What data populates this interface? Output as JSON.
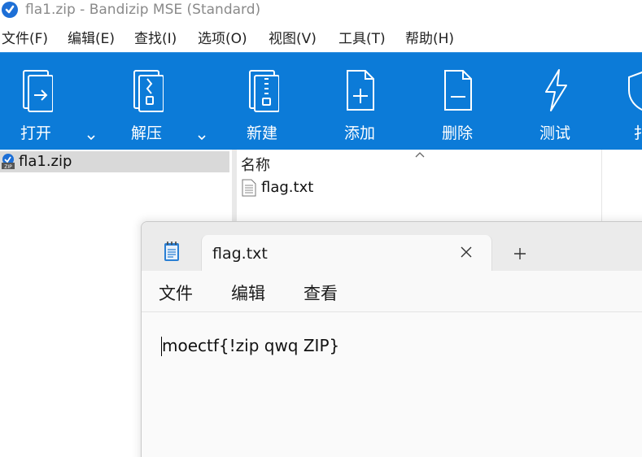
{
  "window": {
    "title": "fla1.zip - Bandizip MSE (Standard)"
  },
  "menubar": {
    "items": [
      {
        "label": "文件(F)"
      },
      {
        "label": "编辑(E)"
      },
      {
        "label": "查找(I)"
      },
      {
        "label": "选项(O)"
      },
      {
        "label": "视图(V)"
      },
      {
        "label": "工具(T)"
      },
      {
        "label": "帮助(H)"
      }
    ]
  },
  "toolbar": {
    "background": "#0c7bd8",
    "buttons": [
      {
        "label": "打开",
        "icon": "open-archive-icon"
      },
      {
        "label": "解压",
        "icon": "extract-icon"
      },
      {
        "label": "新建",
        "icon": "new-archive-icon"
      },
      {
        "label": "添加",
        "icon": "add-file-icon"
      },
      {
        "label": "删除",
        "icon": "delete-file-icon"
      },
      {
        "label": "测试",
        "icon": "test-lightning-icon"
      },
      {
        "label": "扌",
        "icon": "shield-icon"
      }
    ]
  },
  "tree": {
    "items": [
      {
        "label": "fla1.zip",
        "icon": "zip-icon"
      }
    ]
  },
  "filelist": {
    "columns": [
      {
        "label": "名称"
      }
    ],
    "rows": [
      {
        "name": "flag.txt",
        "icon": "text-file-icon"
      }
    ]
  },
  "notepad": {
    "tab": {
      "title": "flag.txt"
    },
    "menus": [
      {
        "label": "文件"
      },
      {
        "label": "编辑"
      },
      {
        "label": "查看"
      }
    ],
    "content": "moectf{!zip qwq ZIP}"
  }
}
